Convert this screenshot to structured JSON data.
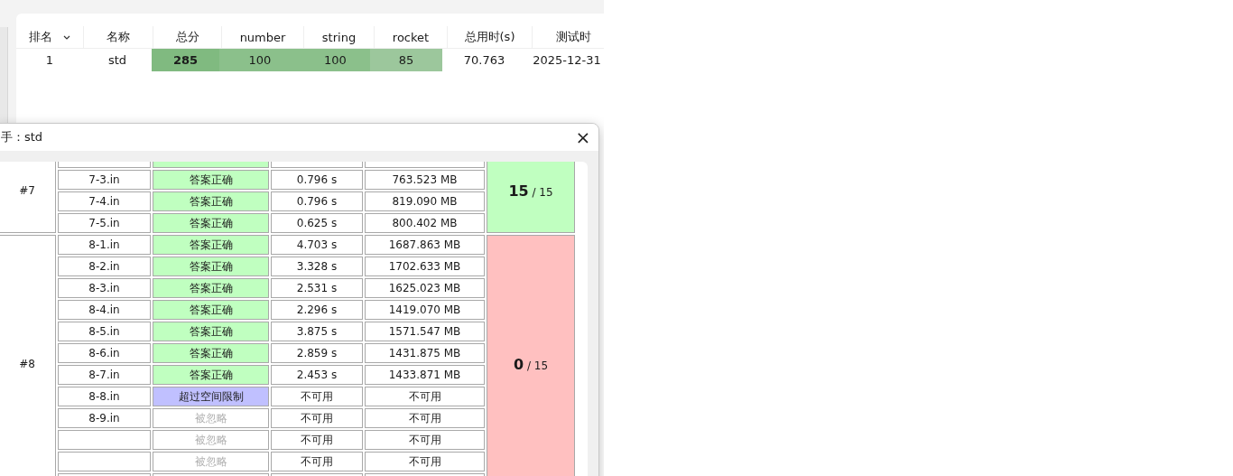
{
  "main_table": {
    "columns": [
      {
        "label": "排名",
        "sorted": true
      },
      {
        "label": "名称",
        "sorted": false
      },
      {
        "label": "总分",
        "sorted": false
      },
      {
        "label": "number",
        "sorted": false
      },
      {
        "label": "string",
        "sorted": false
      },
      {
        "label": "rocket",
        "sorted": false
      },
      {
        "label": "总用时(s)",
        "sorted": false
      },
      {
        "label": "测试时",
        "sorted": false
      }
    ],
    "rows": [
      {
        "cells": [
          {
            "text": "1"
          },
          {
            "text": "std"
          },
          {
            "text": "285",
            "bold": true,
            "color": "#80ba80"
          },
          {
            "text": "100",
            "color": "#8bc08b"
          },
          {
            "text": "100",
            "color": "#8bc08b"
          },
          {
            "text": "85",
            "color": "#9cc79c"
          },
          {
            "text": "70.763"
          },
          {
            "text": "2025-12-31"
          }
        ]
      }
    ]
  },
  "dialog": {
    "title": "手：std",
    "close": "×",
    "subtasks": [
      {
        "label": "#7",
        "score": "15",
        "total": "/ 15",
        "passed": true,
        "cases": [
          {
            "kind": "accepted"
          },
          {
            "kind": "accepted",
            "file": "7-3.in",
            "result": "答案正确",
            "time": "0.796 s",
            "memory": "763.523 MB"
          },
          {
            "kind": "accepted",
            "file": "7-4.in",
            "result": "答案正确",
            "time": "0.796 s",
            "memory": "819.090 MB"
          },
          {
            "kind": "accepted",
            "file": "7-5.in",
            "result": "答案正确",
            "time": "0.625 s",
            "memory": "800.402 MB"
          }
        ]
      },
      {
        "label": "#8",
        "score": "0",
        "total": "/ 15",
        "passed": false,
        "cases": [
          {
            "kind": "accepted",
            "file": "8-1.in",
            "result": "答案正确",
            "time": "4.703 s",
            "memory": "1687.863 MB"
          },
          {
            "kind": "accepted",
            "file": "8-2.in",
            "result": "答案正确",
            "time": "3.328 s",
            "memory": "1702.633 MB"
          },
          {
            "kind": "accepted",
            "file": "8-3.in",
            "result": "答案正确",
            "time": "2.531 s",
            "memory": "1625.023 MB"
          },
          {
            "kind": "accepted",
            "file": "8-4.in",
            "result": "答案正确",
            "time": "2.296 s",
            "memory": "1419.070 MB"
          },
          {
            "kind": "accepted",
            "file": "8-5.in",
            "result": "答案正确",
            "time": "3.875 s",
            "memory": "1571.547 MB"
          },
          {
            "kind": "accepted",
            "file": "8-6.in",
            "result": "答案正确",
            "time": "2.859 s",
            "memory": "1431.875 MB"
          },
          {
            "kind": "accepted",
            "file": "8-7.in",
            "result": "答案正确",
            "time": "2.453 s",
            "memory": "1433.871 MB"
          },
          {
            "kind": "memory",
            "file": "8-8.in",
            "result": "超过空间限制",
            "time": "不可用",
            "memory": "不可用"
          },
          {
            "kind": "ignored",
            "file": "8-9.in",
            "result": "被忽略",
            "time": "不可用",
            "memory": "不可用"
          },
          {
            "kind": "ignored",
            "result": "被忽略",
            "time": "不可用",
            "memory": "不可用"
          },
          {
            "kind": "ignored",
            "result": "被忽略",
            "time": "不可用",
            "memory": "不可用"
          },
          {
            "kind": "blank"
          }
        ]
      }
    ]
  }
}
